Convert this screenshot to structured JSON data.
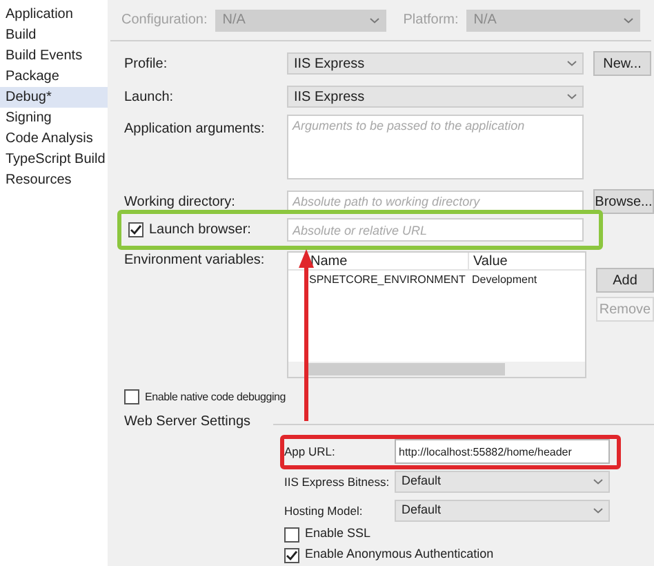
{
  "sidebar": {
    "items": [
      {
        "label": "Application",
        "selected": false
      },
      {
        "label": "Build",
        "selected": false
      },
      {
        "label": "Build Events",
        "selected": false
      },
      {
        "label": "Package",
        "selected": false
      },
      {
        "label": "Debug*",
        "selected": true
      },
      {
        "label": "Signing",
        "selected": false
      },
      {
        "label": "Code Analysis",
        "selected": false
      },
      {
        "label": "TypeScript Build",
        "selected": false
      },
      {
        "label": "Resources",
        "selected": false
      }
    ]
  },
  "toolbar": {
    "configuration": {
      "label": "Configuration:",
      "value": "N/A",
      "disabled": true
    },
    "platform": {
      "label": "Platform:",
      "value": "N/A",
      "disabled": true
    }
  },
  "form": {
    "profile": {
      "label": "Profile:",
      "value": "IIS Express"
    },
    "new_button": "New...",
    "launch": {
      "label": "Launch:",
      "value": "IIS Express"
    },
    "application_arguments": {
      "label": "Application arguments:",
      "placeholder": "Arguments to be passed to the application"
    },
    "working_directory": {
      "label": "Working directory:",
      "placeholder": "Absolute path to working directory"
    },
    "browse_button": "Browse...",
    "launch_browser": {
      "label": "Launch browser:",
      "checked": true,
      "placeholder": "Absolute or relative URL"
    },
    "environment_variables": {
      "label": "Environment variables:",
      "columns": [
        "Name",
        "Value"
      ],
      "rows": [
        [
          "SPNETCORE_ENVIRONMENT",
          "Development"
        ]
      ]
    },
    "buttons": [
      {
        "label": "Add",
        "disabled": false
      },
      {
        "label": "Remove",
        "disabled": true
      }
    ],
    "native_debugging": {
      "label": "Enable native code debugging",
      "checked": false
    }
  },
  "web_server_settings": {
    "title": "Web Server Settings",
    "app_url": {
      "label": "App URL:",
      "value": "http://localhost:55882/home/header"
    },
    "bitness": {
      "label": "IIS Express Bitness:",
      "value": "Default"
    },
    "hosting_model": {
      "label": "Hosting Model:",
      "value": "Default"
    },
    "checkboxes": [
      {
        "label": "Enable SSL",
        "checked": false
      },
      {
        "label": "Enable Anonymous Authentication",
        "checked": true
      }
    ]
  }
}
